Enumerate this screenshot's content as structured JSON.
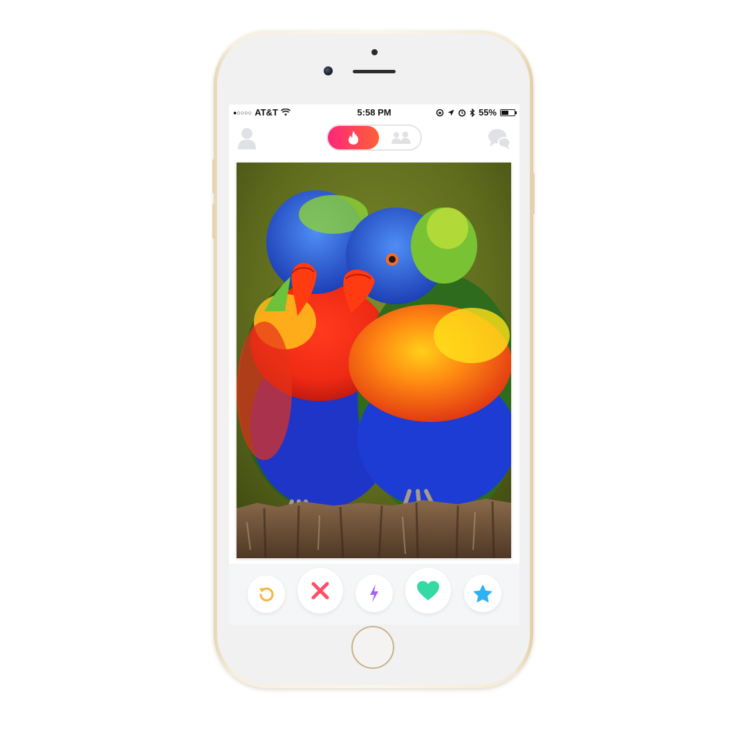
{
  "status_bar": {
    "signal_dots": "●○○○○",
    "carrier": "AT&T",
    "time": "5:58 PM",
    "battery_percent": "55%",
    "battery_level": 0.55
  },
  "nav": {
    "active_mode": "discover",
    "icons": [
      "profile-icon",
      "flame-icon",
      "group-icon",
      "chat-icon"
    ]
  },
  "card": {
    "photo_subject": "two rainbow lorikeets on a wooden post"
  },
  "actions": [
    {
      "name": "rewind",
      "icon": "rewind-icon",
      "color": "#f5b748"
    },
    {
      "name": "nope",
      "icon": "close-icon",
      "color": "#fd5068"
    },
    {
      "name": "boost",
      "icon": "lightning-icon",
      "color": "#a55ff3"
    },
    {
      "name": "like",
      "icon": "heart-icon",
      "color": "#34d9a3"
    },
    {
      "name": "super-like",
      "icon": "star-icon",
      "color": "#2db1f7"
    }
  ],
  "colors": {
    "brand_gradient_start": "#fd267a",
    "brand_gradient_end": "#ff6036",
    "phone_frame": "#f2e7d2",
    "inactive_icon": "#e0e1e5"
  }
}
